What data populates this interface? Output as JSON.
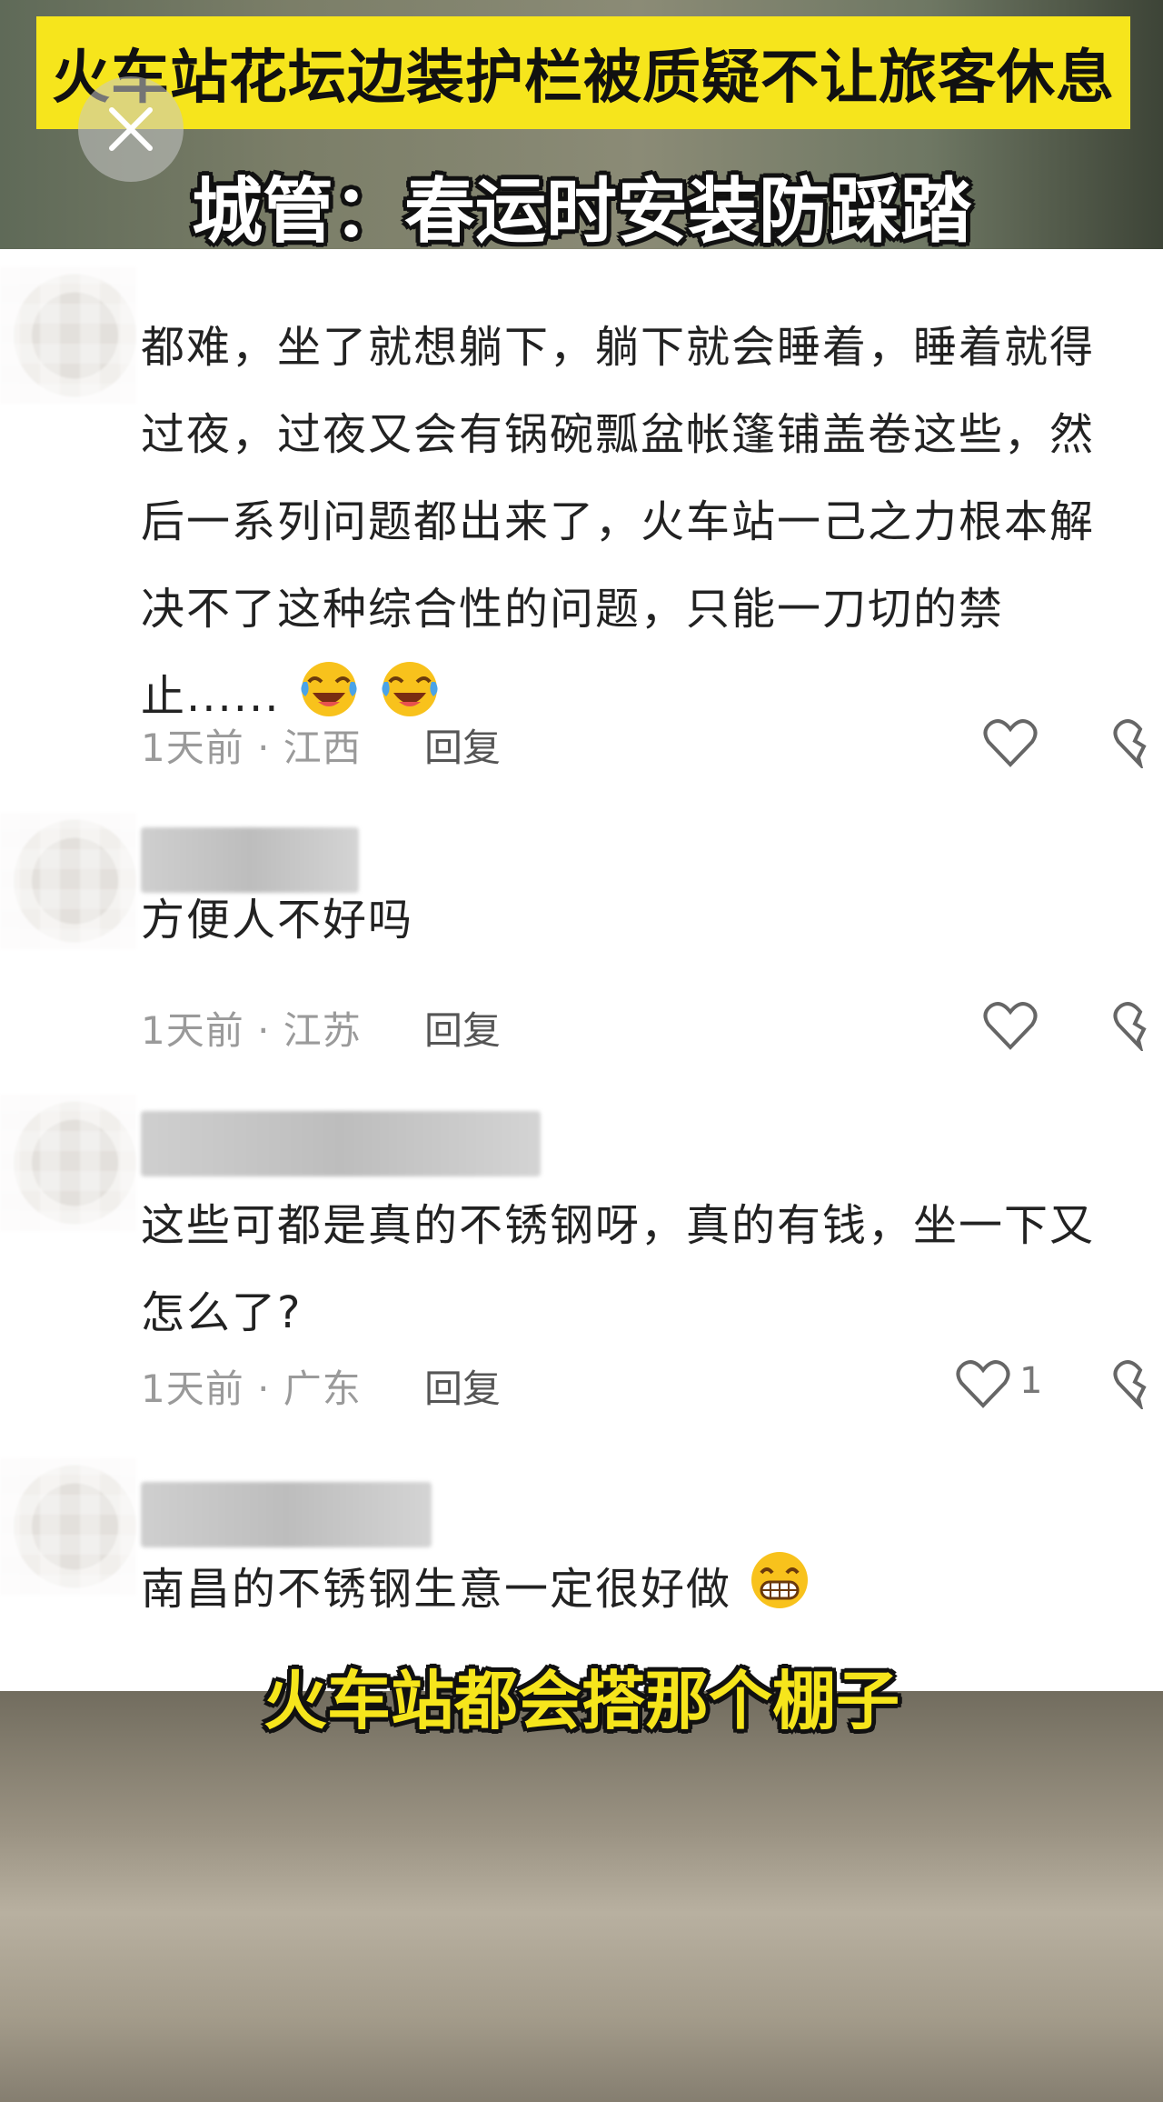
{
  "video": {
    "headline": "火车站花坛边装护栏被质疑不让旅客休息",
    "top_caption": "城管：春运时安装防踩踏",
    "bottom_caption": "火车站都会搭那个棚子"
  },
  "close_button": {
    "icon": "close-icon"
  },
  "comments": [
    {
      "text_lines": [
        "都难，坐了就想躺下，躺下就会睡着，睡着就得",
        "过夜，过夜又会有锅碗瓢盆帐篷铺盖卷这些，然",
        "后一系列问题都出来了，火车站一己之力根本解",
        "决不了这种综合性的问题，只能一刀切的禁",
        "止......"
      ],
      "emojis": [
        "crying-laughing-emoji",
        "crying-laughing-emoji"
      ],
      "meta": "1天前 · 江西",
      "reply": "回复",
      "likes": ""
    },
    {
      "text_lines": [
        "方便人不好吗"
      ],
      "meta": "1天前 · 江苏",
      "reply": "回复",
      "likes": ""
    },
    {
      "text_lines": [
        "这些可都是真的不锈钢呀，真的有钱，坐一下又",
        "怎么了?"
      ],
      "meta": "1天前 · 广东",
      "reply": "回复",
      "likes": "1"
    },
    {
      "text_lines": [
        "南昌的不锈钢生意一定很好做"
      ],
      "emojis": [
        "grinning-emoji"
      ],
      "meta": "",
      "reply": "",
      "likes": ""
    }
  ],
  "colors": {
    "banner": "#f6e51c",
    "panel": "#ffffff",
    "meta_text": "#9a9a9a"
  }
}
